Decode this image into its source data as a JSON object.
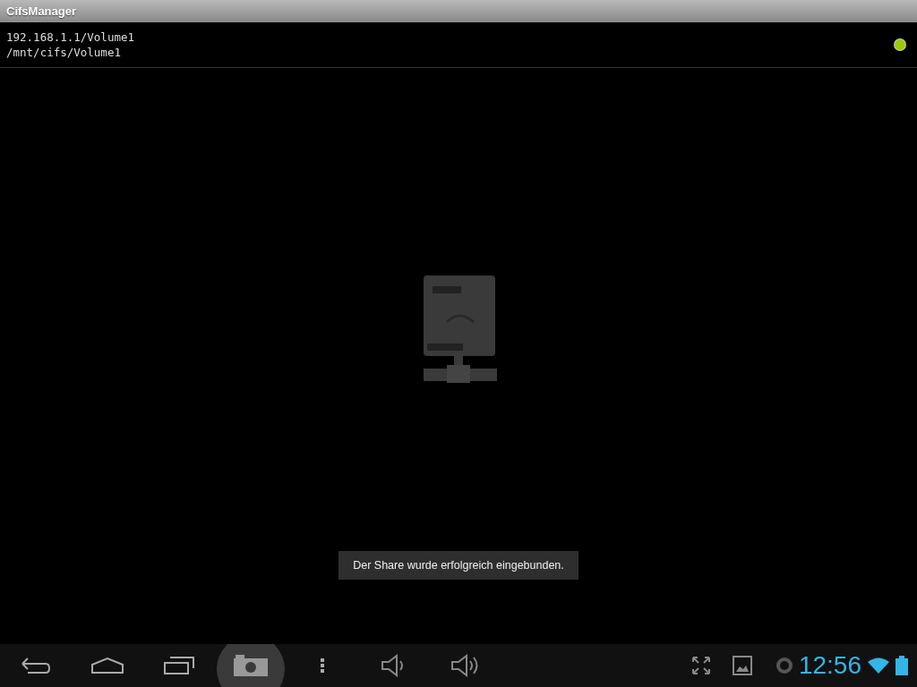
{
  "window": {
    "title": "CifsManager"
  },
  "share": {
    "address": "192.168.1.1/Volume1",
    "mount_point": "/mnt/cifs/Volume1",
    "mounted": true
  },
  "toast": {
    "message": "Der Share wurde erfolgreich eingebunden."
  },
  "status_bar": {
    "time": "12:56"
  }
}
